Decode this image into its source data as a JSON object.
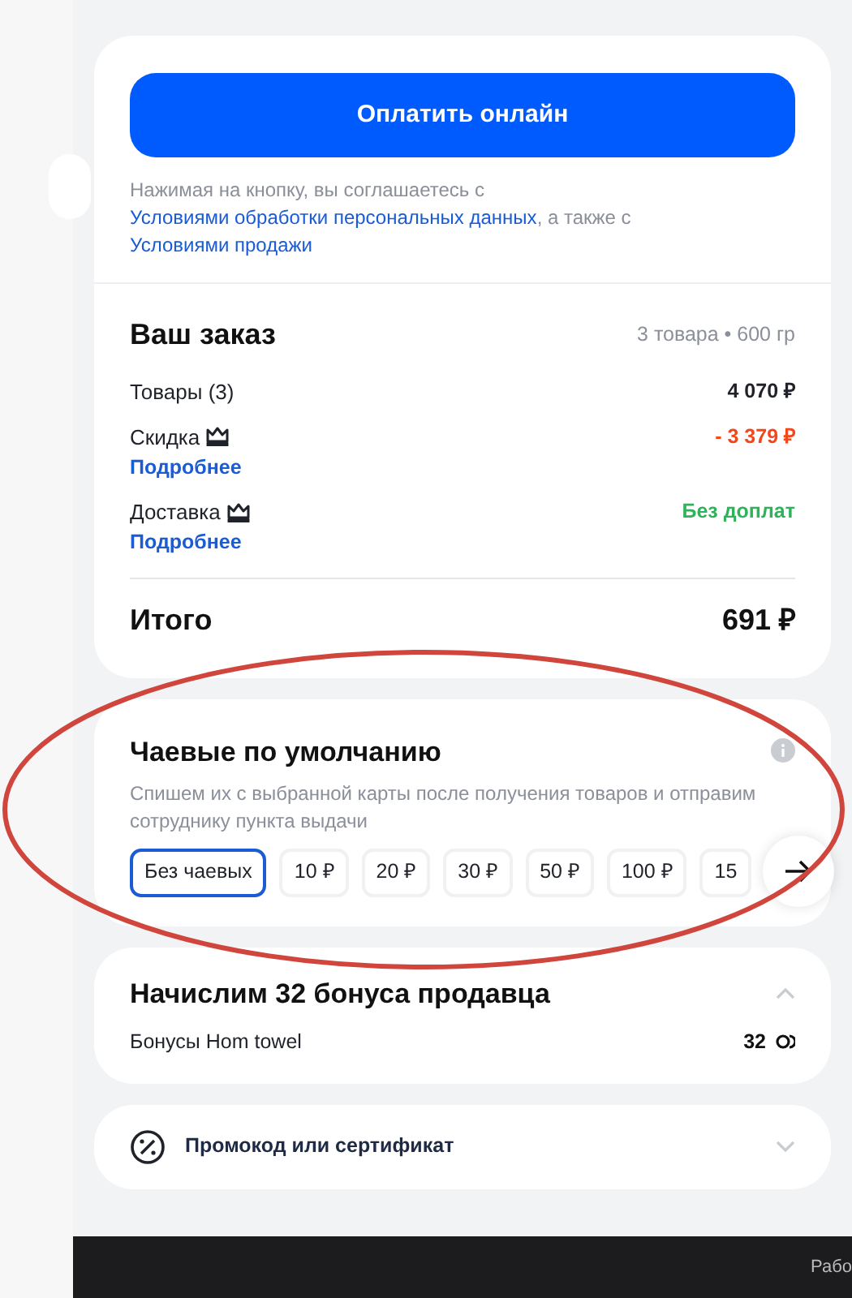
{
  "payment": {
    "button": "Оплатить онлайн",
    "terms": [
      {
        "kind": "text",
        "text": "Нажимая на кнопку, вы соглашаетесь с "
      },
      {
        "kind": "link",
        "text": "Условиями обработки персональных данных"
      },
      {
        "kind": "text",
        "text": ", а также с "
      },
      {
        "kind": "link",
        "text": "Условиями продажи"
      }
    ]
  },
  "order": {
    "title": "Ваш заказ",
    "summary": "3 товара • 600 гр",
    "rows": [
      {
        "label": "Товары (3)",
        "crown": false,
        "value": "4 070 ₽",
        "kind": "price"
      },
      {
        "label": "Скидка",
        "crown": true,
        "link": "Подробнее",
        "value": "- 3 379 ₽",
        "kind": "discount"
      },
      {
        "label": "Доставка",
        "crown": true,
        "link": "Подробнее",
        "value": "Без доплат",
        "kind": "free"
      }
    ],
    "total_label": "Итого",
    "total_value": "691 ₽"
  },
  "tips": {
    "title": "Чаевые по умолчанию",
    "description": "Спишем их с выбранной карты после получения товаров и отправим сотруднику пункта выдачи",
    "options": [
      {
        "label": "Без чаевых",
        "selected": true
      },
      {
        "label": "10 ₽",
        "selected": false
      },
      {
        "label": "20 ₽",
        "selected": false
      },
      {
        "label": "30 ₽",
        "selected": false
      },
      {
        "label": "50 ₽",
        "selected": false
      },
      {
        "label": "100 ₽",
        "selected": false
      },
      {
        "label": "15",
        "selected": false
      }
    ]
  },
  "bonus": {
    "title": "Начислим 32 бонуса продавца",
    "expanded": true,
    "rows": [
      {
        "label": "Бонусы Hom towel",
        "value": "32"
      }
    ]
  },
  "promo": {
    "label": "Промокод или сертификат",
    "expanded": false
  },
  "footer": {
    "text": "Рабо"
  },
  "annotation": {
    "kind": "ellipse"
  }
}
